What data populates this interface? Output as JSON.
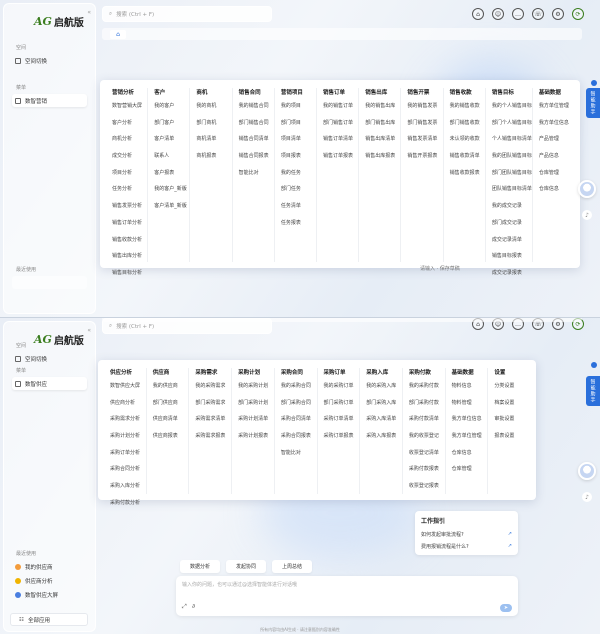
{
  "brand": {
    "mark": "AG",
    "name": "启航版"
  },
  "search": {
    "placeholder": "搜索 (Ctrl + F)"
  },
  "top_icons": [
    "home-icon",
    "robot-icon",
    "chat-icon",
    "support-icon",
    "gear-icon",
    "logout-icon"
  ],
  "sidebar": {
    "space_label": "空间",
    "space_switch": "空间切换",
    "apps_label": "菜单",
    "recent_label": "最近使用",
    "manage_label": "全部应用"
  },
  "assistant_label": "智能助手",
  "panel_top": {
    "active_app": "数智营销",
    "menu": [
      {
        "title": "营销分析",
        "items": [
          "数智营销大屏",
          "客户分析",
          "商机分析",
          "成交分析",
          "项目分析",
          "任务分析",
          "销售发票分析",
          "销售订单分析",
          "销售收款分析",
          "销售出库分析",
          "销售目标分析"
        ]
      },
      {
        "title": "客户",
        "items": [
          "我的客户",
          "部门客户",
          "客户清单",
          "联系人",
          "客户报表",
          "我的客户_新版",
          "客户清单_新版"
        ]
      },
      {
        "title": "商机",
        "items": [
          "我的商机",
          "部门商机",
          "商机清单",
          "商机报表"
        ]
      },
      {
        "title": "销售合同",
        "items": [
          "我的销售合同",
          "部门销售合同",
          "销售合同清单",
          "销售合同报表",
          "智能比对"
        ]
      },
      {
        "title": "营销项目",
        "items": [
          "我的项目",
          "部门项目",
          "项目清单",
          "项目报表",
          "我的任务",
          "部门任务",
          "任务清单",
          "任务报表"
        ]
      },
      {
        "title": "销售订单",
        "items": [
          "我的销售订单",
          "部门销售订单",
          "销售订单清单",
          "销售订单报表"
        ]
      },
      {
        "title": "销售出库",
        "items": [
          "我的销售出库",
          "部门销售出库",
          "销售出库清单",
          "销售出库报表"
        ]
      },
      {
        "title": "销售开票",
        "items": [
          "我的销售发票",
          "部门销售发票",
          "销售发票清单",
          "销售开票报表"
        ]
      },
      {
        "title": "销售收款",
        "items": [
          "我的销售收款",
          "部门销售收款",
          "未认领的收款",
          "销售收款清单",
          "销售收款报表"
        ]
      },
      {
        "title": "销售目标",
        "items": [
          "我的个人销售目标",
          "部门个人销售目标",
          "个人销售目标清单",
          "我的团队销售目标",
          "部门团队销售目标",
          "团队销售目标清单",
          "我的成交记录",
          "部门成交记录",
          "成交记录清单",
          "销售目标报表",
          "成交记录报表"
        ]
      },
      {
        "title": "基础数据",
        "items": [
          "我方单位管理",
          "我方单位信息",
          "产品管理",
          "产品信息",
          "仓库管理",
          "仓库信息"
        ]
      }
    ],
    "ghost_text": "请输入 · 保存草稿"
  },
  "panel_bottom": {
    "active_app": "数智供应",
    "recent_apps": [
      "我的供应商",
      "供应商分析",
      "数智供应大屏"
    ],
    "menu": [
      {
        "title": "供应分析",
        "items": [
          "数智供应大屏",
          "供应商分析",
          "采购需求分析",
          "采购计划分析",
          "采购订单分析",
          "采购合同分析",
          "采购入库分析",
          "采购付款分析"
        ]
      },
      {
        "title": "供应商",
        "items": [
          "我的供应商",
          "部门供应商",
          "供应商清单",
          "供应商报表"
        ]
      },
      {
        "title": "采购需求",
        "items": [
          "我的采购需求",
          "部门采购需求",
          "采购需求清单",
          "采购需求报表"
        ]
      },
      {
        "title": "采购计划",
        "items": [
          "我的采购计划",
          "部门采购计划",
          "采购计划清单",
          "采购计划报表"
        ]
      },
      {
        "title": "采购合同",
        "items": [
          "我的采购合同",
          "部门采购合同",
          "采购合同清单",
          "采购合同报表",
          "智能比对"
        ]
      },
      {
        "title": "采购订单",
        "items": [
          "我的采购订单",
          "部门采购订单",
          "采购订单清单",
          "采购订单报表"
        ]
      },
      {
        "title": "采购入库",
        "items": [
          "我的采购入库",
          "部门采购入库",
          "采购入库清单",
          "采购入库报表"
        ]
      },
      {
        "title": "采购付款",
        "items": [
          "我的采购付款",
          "部门采购付款",
          "采购付款清单",
          "我的收票登记",
          "收票登记清单",
          "采购付款报表",
          "收票登记报表"
        ]
      },
      {
        "title": "基础数据",
        "items": [
          "物料信息",
          "物料管理",
          "我方单位信息",
          "我方单位管理",
          "仓库信息",
          "仓库管理"
        ]
      },
      {
        "title": "设置",
        "items": [
          "分类设置",
          "档案设置",
          "审批设置",
          "报表设置"
        ]
      }
    ],
    "guide": {
      "title": "工作指引",
      "items": [
        "如何发起审批流程?",
        "费用报销流程是什么?"
      ]
    },
    "chips": [
      "数据分析",
      "发起协同",
      "上周总结"
    ],
    "input_placeholder": "输入你的问题，也可以通过@选择智能体进行对话哦",
    "footnote": "所有内容均由AI生成 · 请注意甄别内容准确性"
  }
}
